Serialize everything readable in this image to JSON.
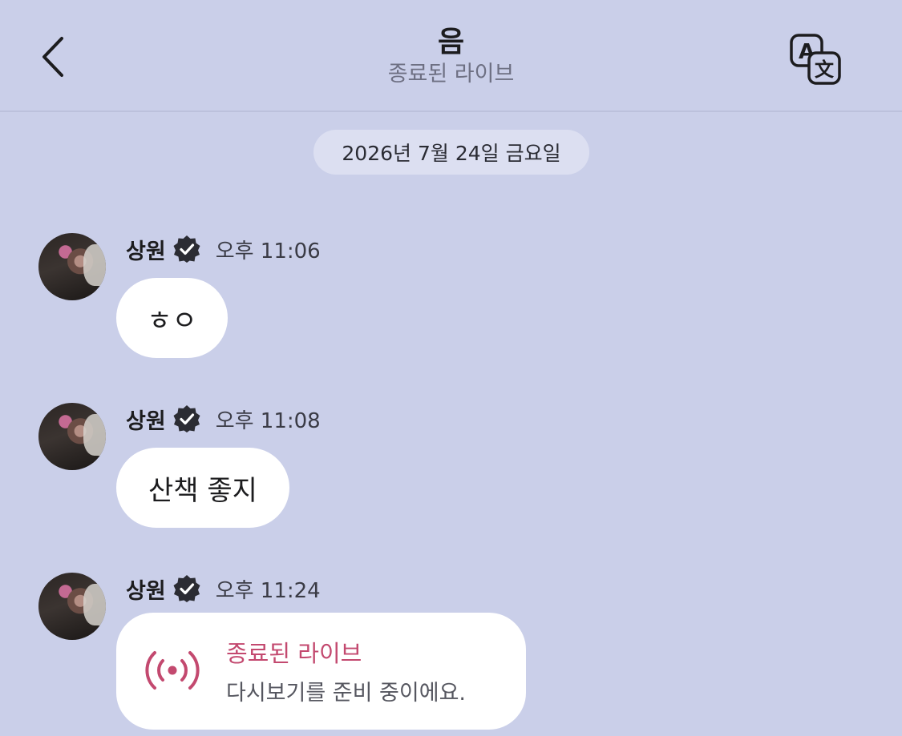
{
  "header": {
    "title": "음",
    "subtitle": "종료된 라이브",
    "back_icon": "chevron-left-icon",
    "translate_icon": "translate-icon"
  },
  "date_divider": "2026년 7월 24일 금요일",
  "messages": [
    {
      "sender": "상원",
      "verified": true,
      "time": "오후 11:06",
      "text": "ㅎㅇ"
    },
    {
      "sender": "상원",
      "verified": true,
      "time": "오후 11:08",
      "text": "산책 좋지"
    },
    {
      "sender": "상원",
      "verified": true,
      "time": "오후 11:24",
      "live_card": {
        "title": "종료된 라이브",
        "description": "다시보기를 준비 중이에요.",
        "icon": "live-broadcast-icon"
      }
    }
  ],
  "colors": {
    "background": "#cacfe9",
    "bubble": "#ffffff",
    "date_pill": "#dcdff1",
    "live_accent": "#c3496f",
    "subtitle": "#6e7083"
  }
}
